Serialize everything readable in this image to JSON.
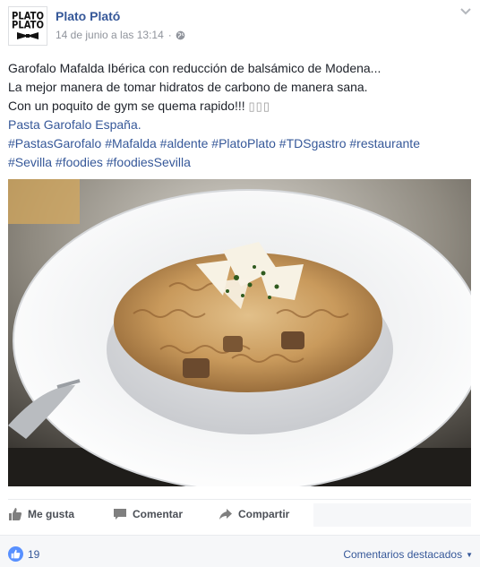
{
  "page": {
    "name": "Plato Plató",
    "timestamp": "14 de junio a las 13:14",
    "separator": "·",
    "avatar_logo_top": "PLATO",
    "avatar_logo_bottom": "PLATÓ"
  },
  "post": {
    "lines": [
      "Garofalo Mafalda Ibérica con reducción de balsámico de Modena...",
      "La mejor manera de tomar hidratos de carbono de manera sana.",
      "Con un poquito de gym se quema rapido!!!"
    ],
    "emoji_placeholder": "▯▯▯",
    "link_text": "Pasta Garofalo España.",
    "hashtags_line1": [
      "#PastasGarofalo",
      "#Mafalda",
      "#aldente",
      "#PlatoPlato",
      "#TDSgastro",
      "#restaurante"
    ],
    "hashtags_line2": [
      "#Sevilla",
      "#foodies",
      "#foodiesSevilla"
    ]
  },
  "actions": {
    "like_label": "Me gusta",
    "comment_label": "Comentar",
    "share_label": "Compartir"
  },
  "footer": {
    "reaction_count": "19",
    "comments_filter_label": "Comentarios destacados",
    "comments_filter_caret": "▼"
  },
  "colors": {
    "link": "#365899",
    "text": "#1d2129",
    "meta": "#90949c",
    "reaction_blue": "#5890ff",
    "footer_bg": "#f6f7f9"
  },
  "icons": [
    "chevron-down-icon",
    "globe-icon",
    "thumbs-up-icon",
    "comment-icon",
    "share-icon",
    "like-reaction-icon"
  ]
}
